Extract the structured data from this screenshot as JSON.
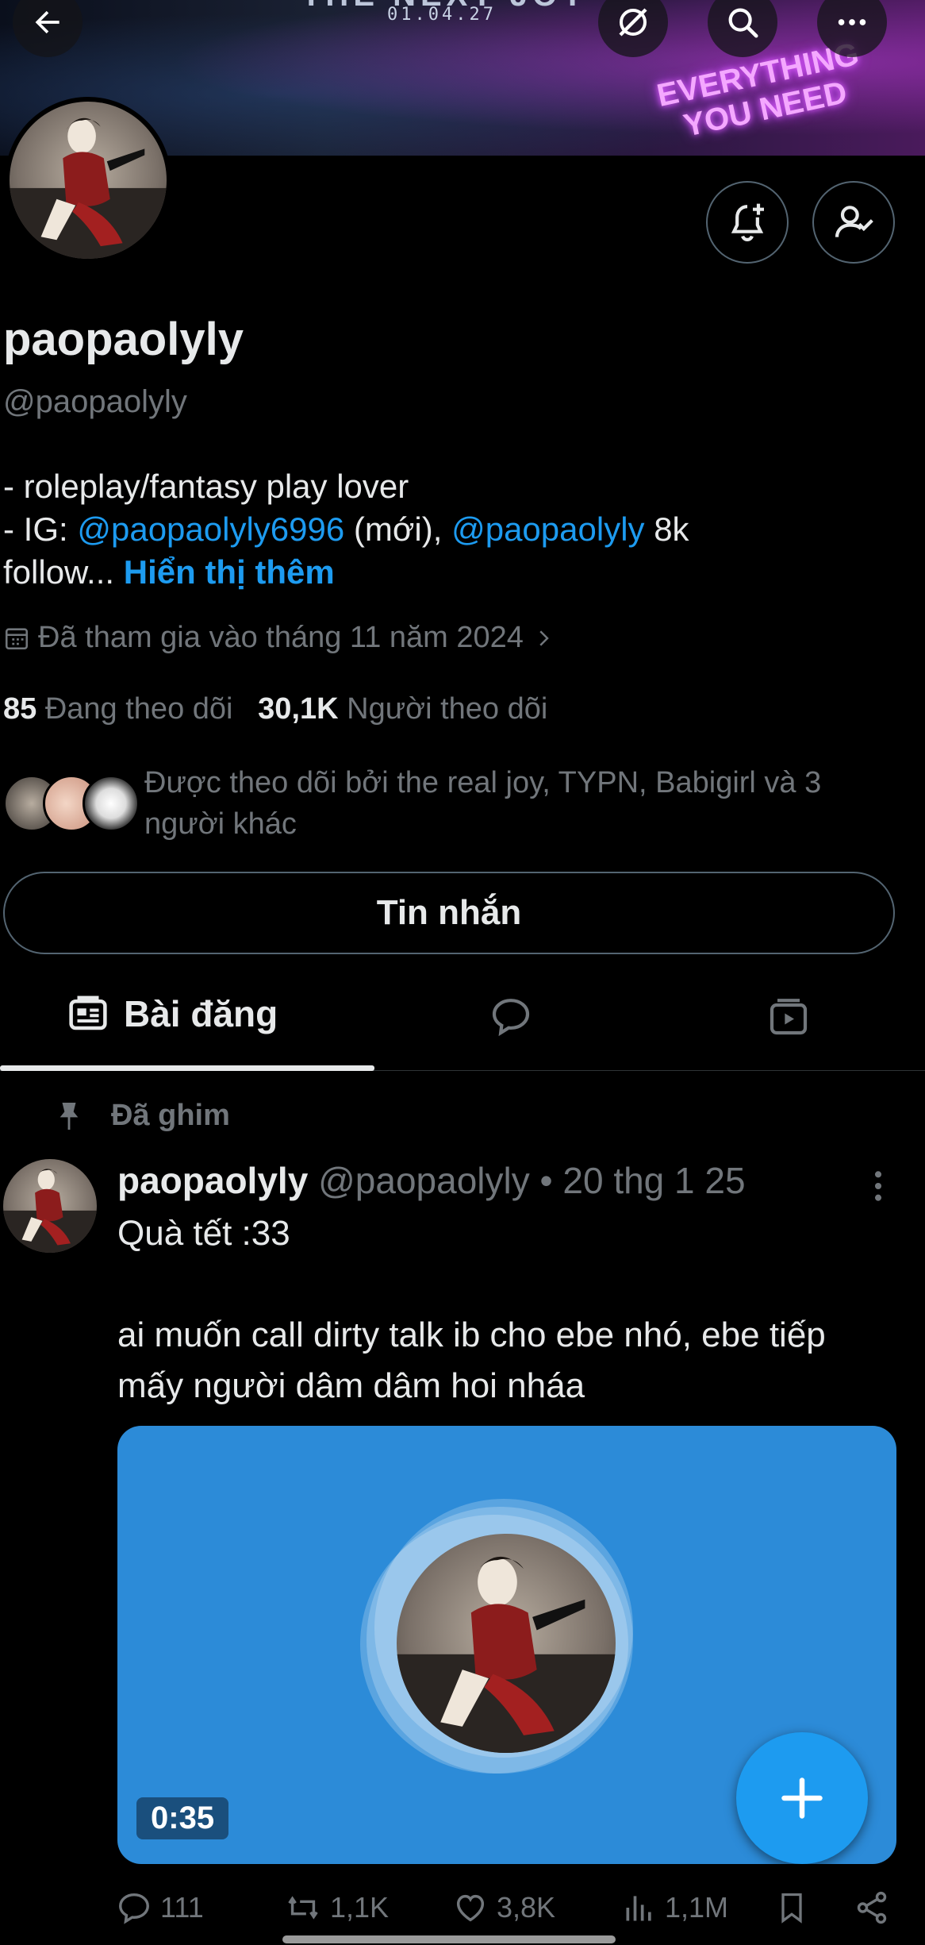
{
  "banner": {
    "title": "THE NEXT JOY",
    "date": "01.04.27",
    "neon_line1": "EVERYTHING",
    "neon_line2": "YOU NEED"
  },
  "profile": {
    "name": "paopaolyly",
    "handle": "@paopaolyly",
    "bio_line1": "- roleplay/fantasy play lover",
    "bio_ig_prefix": "- IG: ",
    "bio_ig_link1": "@paopaolyly6996",
    "bio_ig_mid": " (mới), ",
    "bio_ig_link2": "@paopaolyly",
    "bio_ig_suffix": " 8k",
    "bio_line3": "follow... ",
    "show_more": "Hiển thị thêm",
    "joined": "Đã tham gia vào tháng 11 năm 2024",
    "following_count": "85",
    "following_label": "Đang theo dõi",
    "followers_count": "30,1K",
    "followers_label": "Người theo dõi",
    "followed_by": "Được theo dõi bởi the real joy, TYPN, Babigirl và 3 người khác"
  },
  "buttons": {
    "message": "Tin nhắn"
  },
  "tabs": {
    "posts": "Bài đăng"
  },
  "post": {
    "pinned_label": "Đã ghim",
    "author": "paopaolyly",
    "meta": " @paopaolyly • 20 thg 1 25",
    "text": "Quà tết :33\n\nai muốn call dirty talk ib cho ebe nhó, ebe tiếp mấy người dâm dâm hoi nháa",
    "duration": "0:35",
    "replies": "111",
    "reposts": "1,1K",
    "likes": "3,8K",
    "views": "1,1M"
  },
  "colors": {
    "accent": "#1d9bf0",
    "media_bg": "#2c8bd8",
    "muted": "#71767b"
  }
}
